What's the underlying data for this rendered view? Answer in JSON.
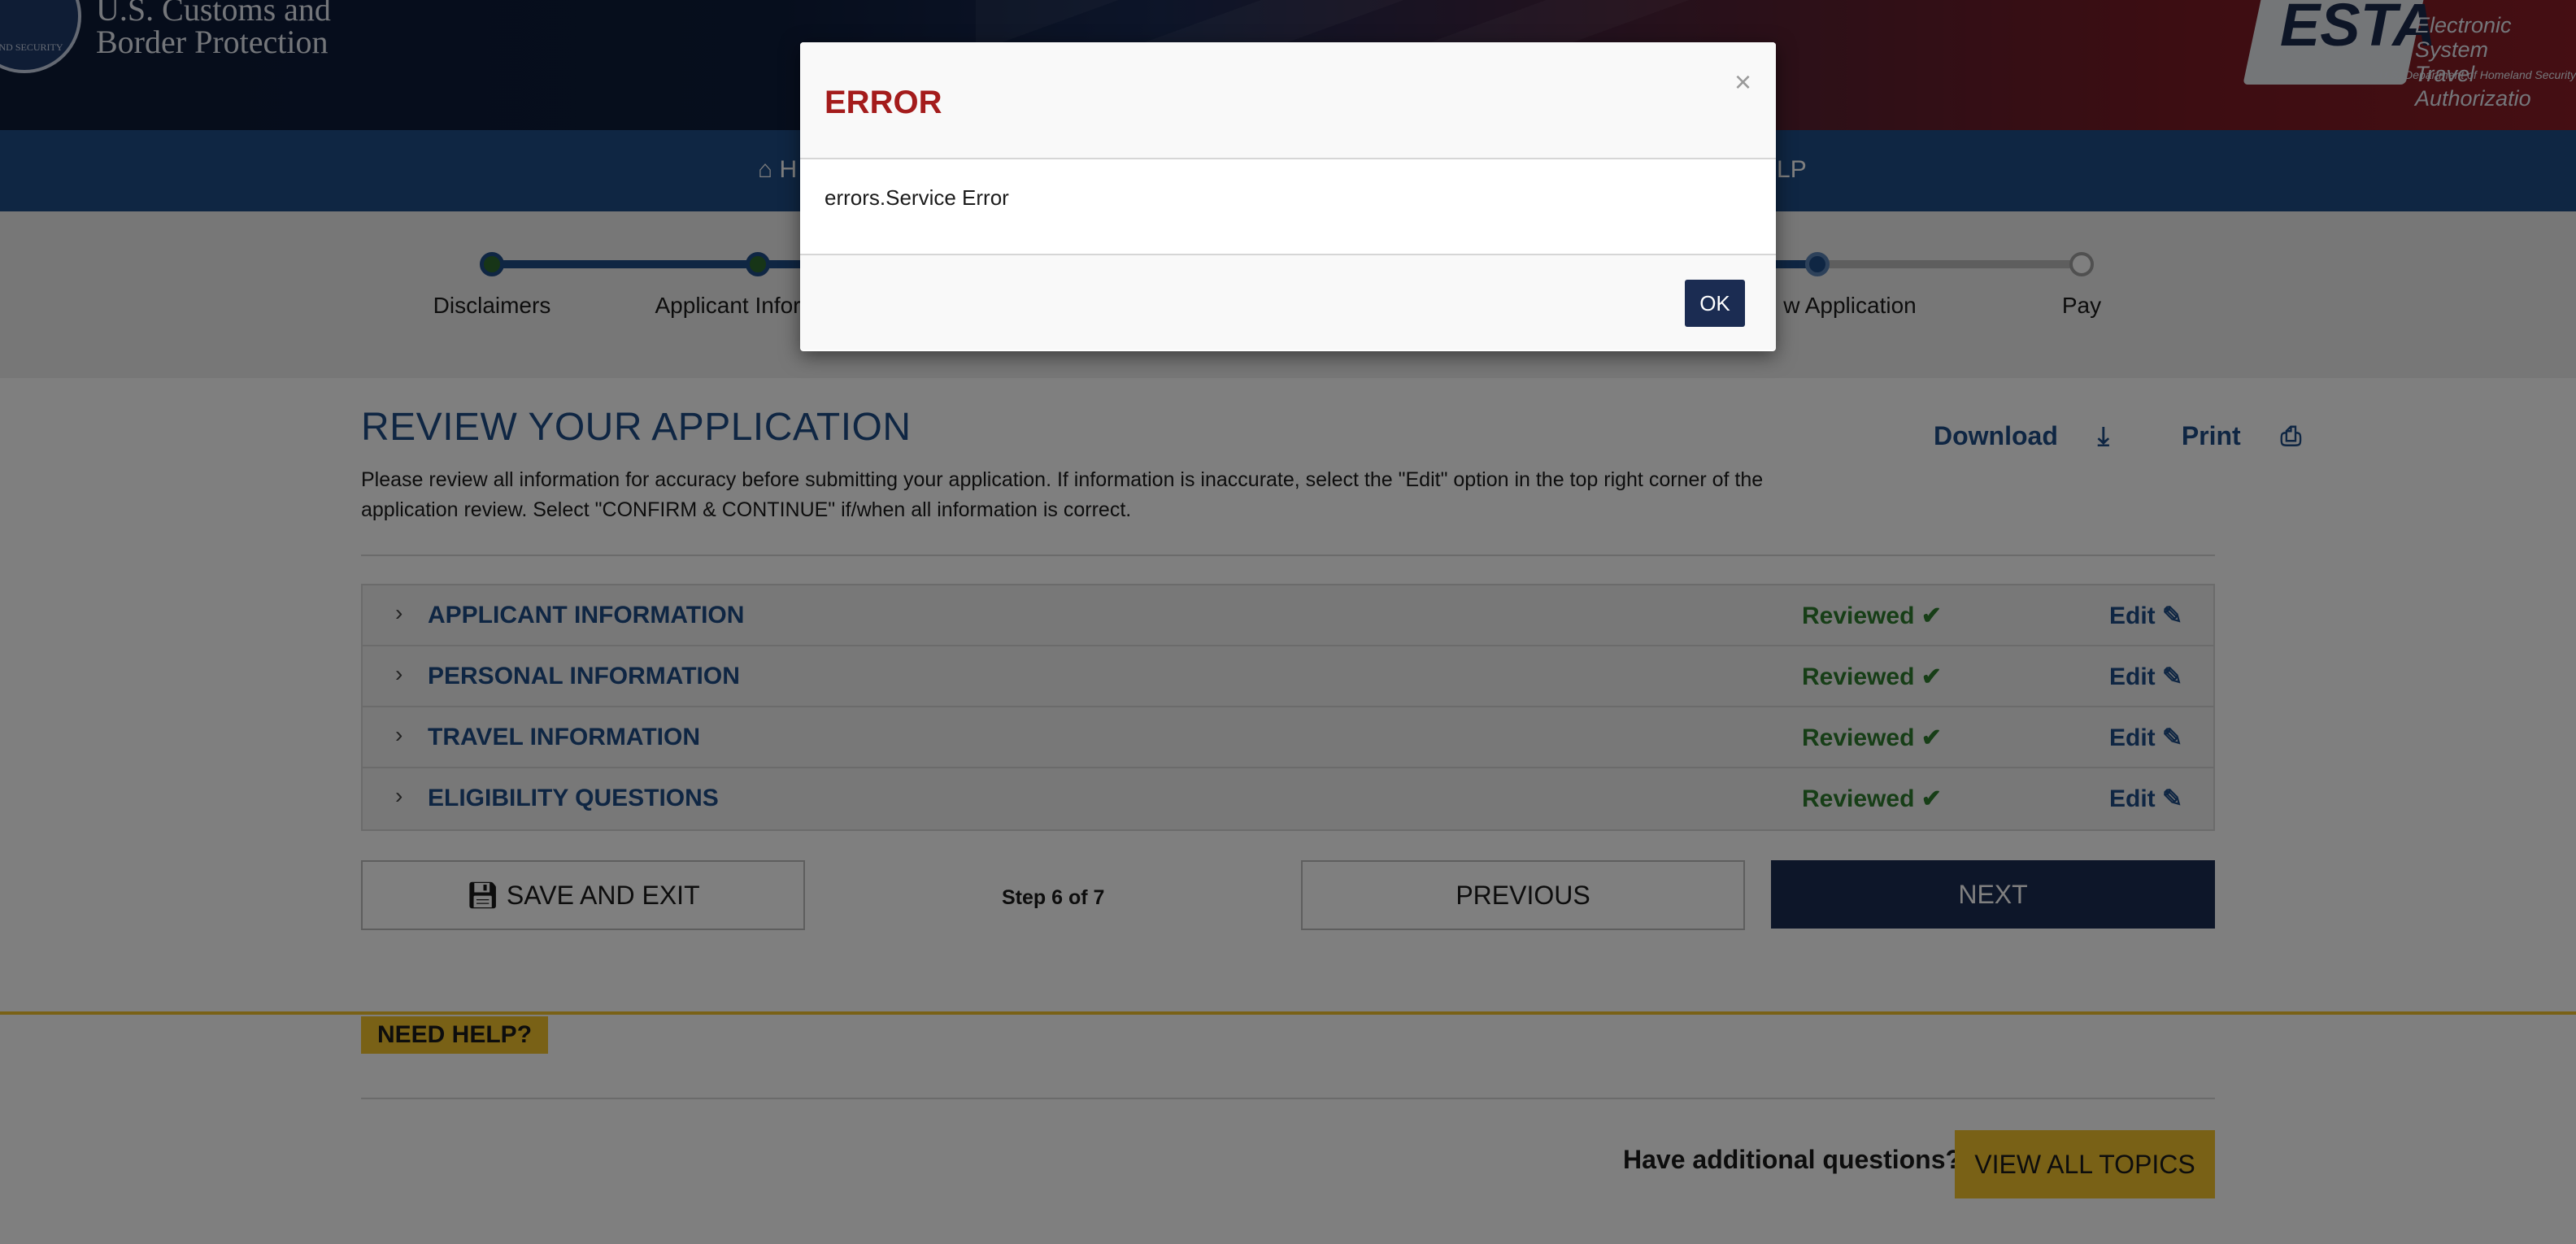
{
  "header": {
    "seal_label": "LAND SECURITY",
    "agency_name_line1": "U.S. Customs and",
    "agency_name_line2": "Border Protection",
    "esta_logo": "ESTA",
    "esta_line1": "Electronic System",
    "esta_line2": "Travel Authorizatio",
    "esta_sub": "U.S. Department of Homeland Security"
  },
  "nav": {
    "home_icon": "home-icon",
    "home_label": "H",
    "help_label": "ELP"
  },
  "progress": {
    "steps": [
      {
        "label": "Disclaimers",
        "state": "done"
      },
      {
        "label": "Applicant Infor",
        "state": "done"
      },
      {
        "label": "w Application",
        "state": "current"
      },
      {
        "label": "Pay",
        "state": "todo"
      }
    ]
  },
  "main": {
    "title": "REVIEW YOUR APPLICATION",
    "intro": "Please review all information for accuracy before submitting your application. If information is inaccurate, select the \"Edit\" option in the top right corner of the application review. Select \"CONFIRM & CONTINUE\" if/when all information is correct.",
    "download_label": "Download",
    "print_label": "Print",
    "sections": [
      {
        "title": "APPLICANT INFORMATION",
        "status": "Reviewed",
        "edit": "Edit"
      },
      {
        "title": "PERSONAL INFORMATION",
        "status": "Reviewed",
        "edit": "Edit"
      },
      {
        "title": "TRAVEL INFORMATION",
        "status": "Reviewed",
        "edit": "Edit"
      },
      {
        "title": "ELIGIBILITY QUESTIONS",
        "status": "Reviewed",
        "edit": "Edit"
      }
    ],
    "save_exit_label": "SAVE AND EXIT",
    "step_count": "Step 6 of 7",
    "previous_label": "PREVIOUS",
    "next_label": "NEXT"
  },
  "help": {
    "tag": "NEED HELP?",
    "question": "Have additional questions?",
    "topics_label": "VIEW ALL TOPICS"
  },
  "modal": {
    "title": "ERROR",
    "close": "×",
    "message": "errors.Service Error",
    "ok_label": "OK"
  },
  "colors": {
    "brand_blue": "#1f4c86",
    "navy": "#1b2c52",
    "error_red": "#a41c1c",
    "success_green": "#2e7d2e",
    "accent_yellow": "#f3c22c"
  }
}
